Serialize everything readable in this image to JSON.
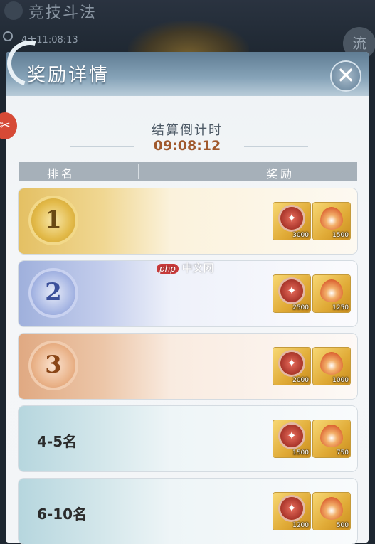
{
  "background": {
    "screen_title": "竞技斗法",
    "timer_text": "4天11:08:13",
    "right_icon": "流"
  },
  "dialog": {
    "title": "奖励详情",
    "close_icon": "close-icon",
    "countdown_label": "结算倒计时",
    "countdown_value": "09:08:12",
    "columns": {
      "rank": "排名",
      "reward": "奖励"
    }
  },
  "ranks": [
    {
      "label": "1",
      "medal": true,
      "rewards": [
        {
          "icon": "spirit-stone-icon",
          "count": "3000"
        },
        {
          "icon": "flame-drop-icon",
          "count": "1500"
        }
      ]
    },
    {
      "label": "2",
      "medal": true,
      "rewards": [
        {
          "icon": "spirit-stone-icon",
          "count": "2500"
        },
        {
          "icon": "flame-drop-icon",
          "count": "1250"
        }
      ]
    },
    {
      "label": "3",
      "medal": true,
      "rewards": [
        {
          "icon": "spirit-stone-icon",
          "count": "2000"
        },
        {
          "icon": "flame-drop-icon",
          "count": "1000"
        }
      ]
    },
    {
      "label": "4-5名",
      "medal": false,
      "rewards": [
        {
          "icon": "spirit-stone-icon",
          "count": "1500"
        },
        {
          "icon": "flame-drop-icon",
          "count": "750"
        }
      ]
    },
    {
      "label": "6-10名",
      "medal": false,
      "rewards": [
        {
          "icon": "spirit-stone-icon",
          "count": "1200"
        },
        {
          "icon": "flame-drop-icon",
          "count": "500"
        }
      ]
    }
  ],
  "watermark": {
    "brand": "php",
    "text": "中文网"
  },
  "colors": {
    "gold": "#e4c063",
    "silver": "#9fb0dc",
    "bronze": "#e0a982",
    "countdown": "#a0592d"
  }
}
